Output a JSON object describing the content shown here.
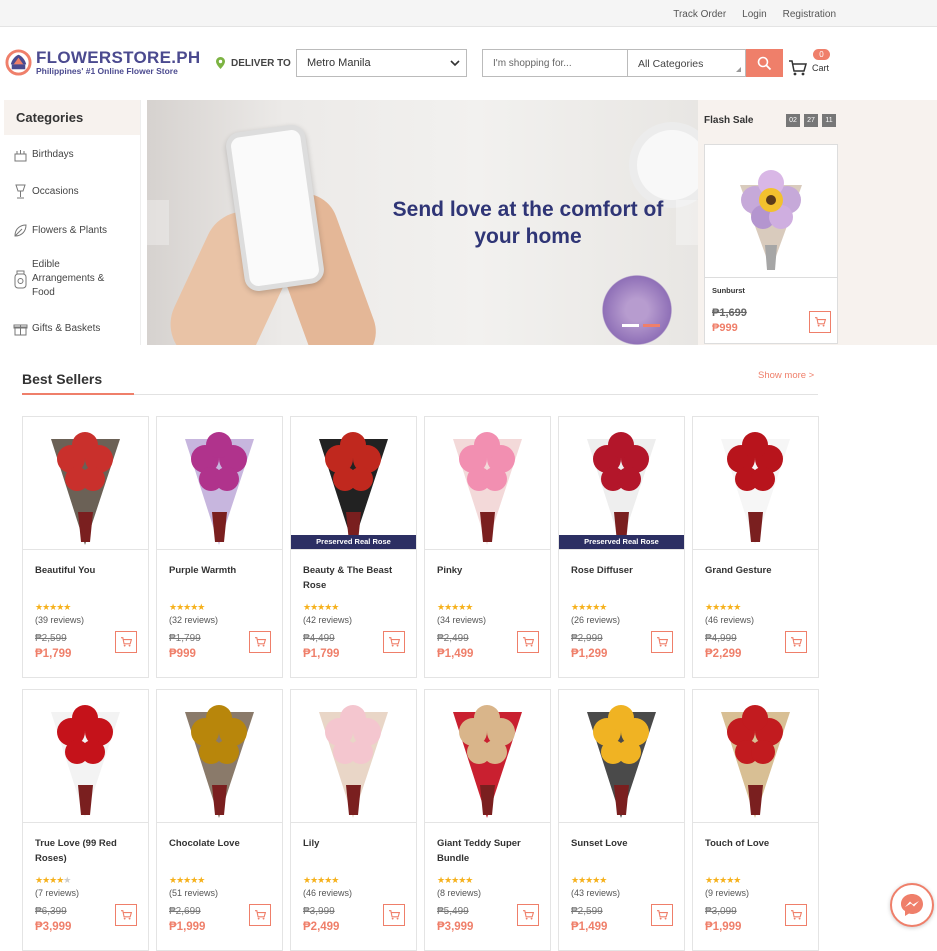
{
  "topbar": {
    "links": [
      "Track Order",
      "Login",
      "Registration"
    ]
  },
  "header": {
    "logo_name": "FLOWERSTORE.PH",
    "logo_tagline": "Philippines' #1 Online Flower Store",
    "deliver_label": "DELIVER TO",
    "location_value": "Metro Manila",
    "search_placeholder": "I'm shopping for...",
    "category_value": "All Categories",
    "cart_count": "0",
    "cart_label": "Cart"
  },
  "sidebar": {
    "title": "Categories",
    "items": [
      {
        "label": "Birthdays",
        "icon": "cake-icon"
      },
      {
        "label": "Occasions",
        "icon": "glass-icon"
      },
      {
        "label": "Flowers & Plants",
        "icon": "leaf-icon"
      },
      {
        "label": "Edible Arrangements & Food",
        "icon": "jar-icon"
      },
      {
        "label": "Gifts & Baskets",
        "icon": "gift-icon"
      }
    ]
  },
  "banner": {
    "headline": "Send love at the comfort of your home"
  },
  "flash_sale": {
    "title": "Flash Sale",
    "timer": [
      "02",
      "27",
      "11"
    ],
    "product": {
      "name": "Sunburst",
      "old_price": "₱1,699",
      "new_price": "₱999"
    }
  },
  "best_sellers": {
    "title": "Best Sellers",
    "show_more": "Show more >",
    "products": [
      {
        "name": "Beautiful You",
        "rating": 4.5,
        "reviews": "(39 reviews)",
        "old_price": "₱2,599",
        "new_price": "₱1,799",
        "ribbon": ""
      },
      {
        "name": "Purple Warmth",
        "rating": 4.5,
        "reviews": "(32 reviews)",
        "old_price": "₱1,799",
        "new_price": "₱999",
        "ribbon": ""
      },
      {
        "name": "Beauty & The Beast Rose",
        "rating": 4.5,
        "reviews": "(42 reviews)",
        "old_price": "₱4,499",
        "new_price": "₱1,799",
        "ribbon": "Preserved Real Rose"
      },
      {
        "name": "Pinky",
        "rating": 4.5,
        "reviews": "(34 reviews)",
        "old_price": "₱2,499",
        "new_price": "₱1,499",
        "ribbon": ""
      },
      {
        "name": "Rose Diffuser",
        "rating": 4.5,
        "reviews": "(26 reviews)",
        "old_price": "₱2,999",
        "new_price": "₱1,299",
        "ribbon": "Preserved Real Rose"
      },
      {
        "name": "Grand Gesture",
        "rating": 4.5,
        "reviews": "(46 reviews)",
        "old_price": "₱4,999",
        "new_price": "₱2,299",
        "ribbon": ""
      },
      {
        "name": "True Love (99 Red Roses)",
        "rating": 4,
        "reviews": "(7 reviews)",
        "old_price": "₱6,399",
        "new_price": "₱3,999",
        "ribbon": ""
      },
      {
        "name": "Chocolate Love",
        "rating": 4.5,
        "reviews": "(51 reviews)",
        "old_price": "₱2,699",
        "new_price": "₱1,999",
        "ribbon": ""
      },
      {
        "name": "Lily",
        "rating": 4.5,
        "reviews": "(46 reviews)",
        "old_price": "₱3,999",
        "new_price": "₱2,499",
        "ribbon": ""
      },
      {
        "name": "Giant Teddy Super Bundle",
        "rating": 4.5,
        "reviews": "(8 reviews)",
        "old_price": "₱5,499",
        "new_price": "₱3,999",
        "ribbon": ""
      },
      {
        "name": "Sunset Love",
        "rating": 4.5,
        "reviews": "(43 reviews)",
        "old_price": "₱2,599",
        "new_price": "₱1,499",
        "ribbon": ""
      },
      {
        "name": "Touch of Love",
        "rating": 4.5,
        "reviews": "(9 reviews)",
        "old_price": "₱3,099",
        "new_price": "₱1,999",
        "ribbon": ""
      }
    ]
  },
  "colors": {
    "accent": "#ef7f6a",
    "brand": "#4b4a8f",
    "ribbon": "#2c2f63",
    "star": "#f6b11c"
  },
  "messenger_icon": "messenger-icon"
}
